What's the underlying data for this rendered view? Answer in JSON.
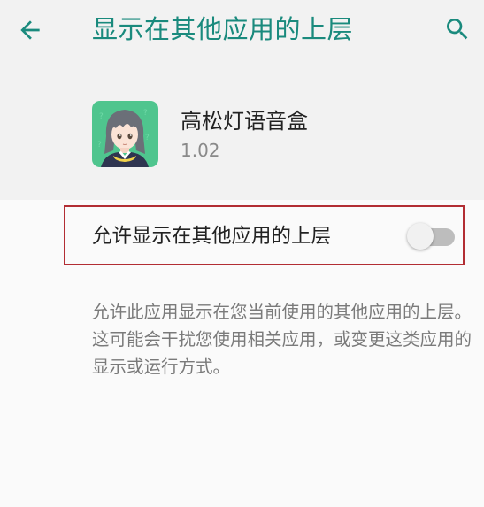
{
  "toolbar": {
    "title": "显示在其他应用的上层",
    "back_icon": "arrow-left-icon",
    "search_icon": "search-icon",
    "accent_color": "#1a8a7d"
  },
  "app": {
    "name": "高松灯语音盒",
    "version": "1.02",
    "icon": "app-icon-anime-character"
  },
  "permission": {
    "label": "允许显示在其他应用的上层",
    "enabled": false
  },
  "description": "允许此应用显示在您当前使用的其他应用的上层。这可能会干扰您使用相关应用，或变更这类应用的显示或运行方式。"
}
